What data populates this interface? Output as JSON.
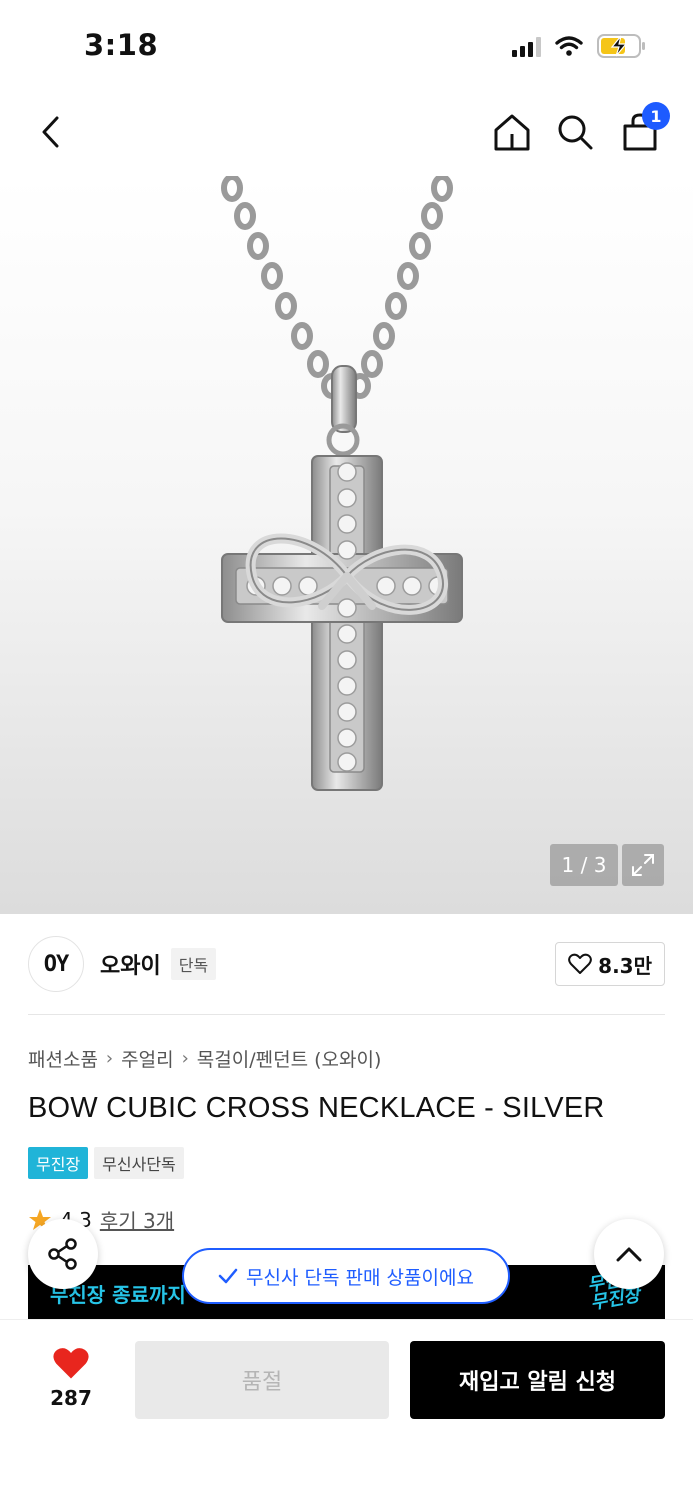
{
  "status": {
    "time": "3:18"
  },
  "nav": {
    "cart_count": "1"
  },
  "gallery": {
    "counter": "1 / 3"
  },
  "brand": {
    "logo_text": "OY",
    "name": "오와이",
    "tag": "단독",
    "likes": "8.3만"
  },
  "breadcrumb": [
    "패션소품",
    "주얼리",
    "목걸이/펜던트 (오와이)"
  ],
  "product": {
    "title": "BOW CUBIC CROSS NECKLACE - SILVER",
    "tags": [
      "무진장",
      "무신사단독"
    ],
    "rating": "4.3",
    "reviews": "후기 3개"
  },
  "promo": {
    "text": "무진장 종료까지",
    "logo_line1": "무신사",
    "logo_line2": "무진장"
  },
  "toast": {
    "text": "무신사 단독 판매 상품이에요"
  },
  "bottom": {
    "heart_count": "287",
    "soldout_label": "품절",
    "restock_label": "재입고 알림 신청"
  },
  "colors": {
    "accent_blue": "#1d5bff",
    "cyan": "#20b4d8",
    "heart_red": "#e8261e",
    "star": "#f5a623"
  }
}
